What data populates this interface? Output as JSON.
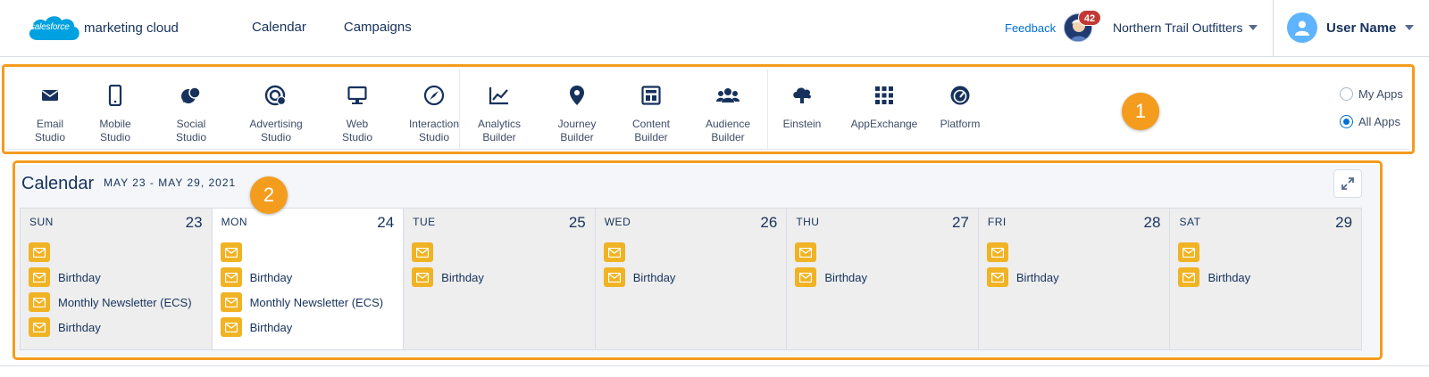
{
  "header": {
    "logo_badge": "salesforce",
    "logo_product": "marketing cloud",
    "nav": [
      "Calendar",
      "Campaigns"
    ],
    "feedback": "Feedback",
    "notifications": "42",
    "org_name": "Northern Trail Outfitters",
    "user_name": "User Name"
  },
  "apps": [
    {
      "label": "Email\nStudio",
      "icon": "email-icon"
    },
    {
      "label": "Mobile\nStudio",
      "icon": "mobile-icon"
    },
    {
      "label": "Social\nStudio",
      "icon": "social-icon"
    },
    {
      "label": "Advertising\nStudio",
      "icon": "advertising-icon"
    },
    {
      "label": "Web\nStudio",
      "icon": "web-icon"
    },
    {
      "label": "Interaction\nStudio",
      "icon": "interaction-icon"
    },
    {
      "label": "Analytics\nBuilder",
      "icon": "analytics-icon"
    },
    {
      "label": "Journey\nBuilder",
      "icon": "journey-icon"
    },
    {
      "label": "Content\nBuilder",
      "icon": "content-icon"
    },
    {
      "label": "Audience\nBuilder",
      "icon": "audience-icon"
    },
    {
      "label": "Einstein",
      "icon": "einstein-icon"
    },
    {
      "label": "AppExchange",
      "icon": "appexchange-icon"
    },
    {
      "label": "Platform",
      "icon": "platform-icon"
    }
  ],
  "app_filter": {
    "options": [
      "My Apps",
      "All Apps"
    ],
    "selected": "All Apps"
  },
  "callouts": [
    "1",
    "2"
  ],
  "calendar": {
    "title": "Calendar",
    "range": "MAY 23 - MAY 29, 2021",
    "days": [
      {
        "name": "SUN",
        "num": "23",
        "today": false,
        "events": [
          "",
          "Birthday",
          "Monthly Newsletter (ECS)",
          "Birthday"
        ]
      },
      {
        "name": "MON",
        "num": "24",
        "today": true,
        "events": [
          "",
          "Birthday",
          "Monthly Newsletter (ECS)",
          "Birthday"
        ]
      },
      {
        "name": "TUE",
        "num": "25",
        "today": false,
        "events": [
          "",
          "Birthday"
        ]
      },
      {
        "name": "WED",
        "num": "26",
        "today": false,
        "events": [
          "",
          "Birthday"
        ]
      },
      {
        "name": "THU",
        "num": "27",
        "today": false,
        "events": [
          "",
          "Birthday"
        ]
      },
      {
        "name": "FRI",
        "num": "28",
        "today": false,
        "events": [
          "",
          "Birthday"
        ]
      },
      {
        "name": "SAT",
        "num": "29",
        "today": false,
        "events": [
          "",
          "Birthday"
        ]
      }
    ]
  },
  "colors": {
    "accent": "#f39c1e",
    "brand_blue": "#00a1e0",
    "navy": "#16325c",
    "email_tile": "#f0b323",
    "badge_red": "#c23934"
  }
}
